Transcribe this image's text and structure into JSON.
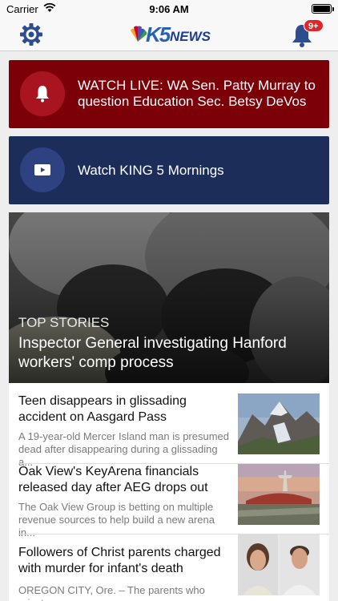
{
  "status_bar": {
    "carrier": "Carrier",
    "time": "9:06 AM",
    "battery_level": 1.0
  },
  "nav": {
    "logo_text": "K5",
    "logo_news": "NEWS",
    "notification_badge": "9+",
    "settings_icon": "gear-icon",
    "notifications_icon": "bell-icon"
  },
  "alerts": [
    {
      "label": "WATCH LIVE: WA Sen. Patty Murray to question Education Sec. Betsy DeVos",
      "icon": "bell-icon",
      "color": "#7c0008"
    },
    {
      "label": "Watch KING 5 Mornings",
      "icon": "play-icon",
      "color": "#1d2d59"
    }
  ],
  "top_story": {
    "section": "TOP STORIES",
    "headline": "Inspector General investigating Hanford workers' comp process"
  },
  "stories": [
    {
      "title": "Teen disappears in glissading accident on Aasgard Pass",
      "summary": "A 19-year-old Mercer Island man is presumed dead after disappearing during a glissading a..."
    },
    {
      "title": "Oak View's KeyArena financials released day after AEG drops out",
      "summary": "The Oak View Group is betting on multiple revenue sources to help build a new arena in..."
    },
    {
      "title": "Followers of Christ parents charged with murder for infant's death",
      "summary": "OREGON CITY, Ore. – The parents who reject..."
    }
  ],
  "colors": {
    "live_card": "#7c0008",
    "watch_card": "#1d2d59",
    "badge": "#e0252b",
    "brand_blue": "#2a62b3"
  }
}
